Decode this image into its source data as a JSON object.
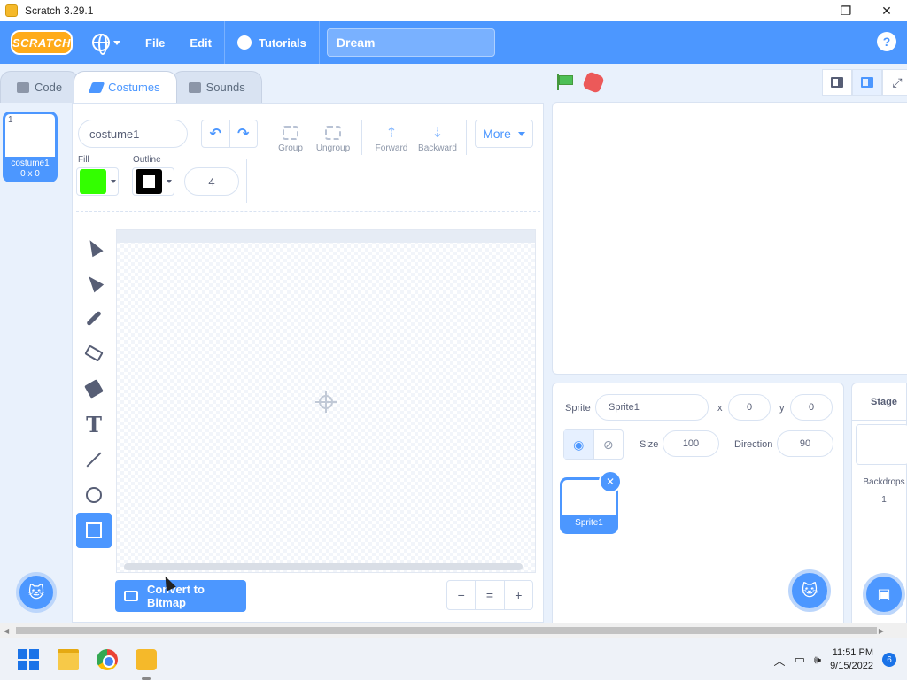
{
  "window": {
    "title": "Scratch 3.29.1",
    "controls": [
      "—",
      "❐",
      "✕"
    ]
  },
  "menubar": {
    "logo": "SCRATCH",
    "file": "File",
    "edit": "Edit",
    "tutorials": "Tutorials",
    "project_title": "Dream",
    "help": "?"
  },
  "tabs": [
    {
      "label": "Code",
      "icon": "code-icon"
    },
    {
      "label": "Costumes",
      "icon": "brush-icon",
      "active": true
    },
    {
      "label": "Sounds",
      "icon": "speaker-icon"
    }
  ],
  "costume_list": {
    "items": [
      {
        "number": "1",
        "name": "costume1",
        "size": "0 x 0"
      }
    ]
  },
  "paint_editor": {
    "costume_name": "costume1",
    "group_label": "Group",
    "ungroup_label": "Ungroup",
    "forward_label": "Forward",
    "backward_label": "Backward",
    "more_label": "More",
    "fill_label": "Fill",
    "outline_label": "Outline",
    "fill_color": "#33ff00",
    "outline_color": "#000000",
    "outline_width": "4",
    "convert_label": "Convert to Bitmap",
    "tools": [
      "select-icon",
      "reshape-icon",
      "brush-icon",
      "eraser-icon",
      "fill-icon",
      "text-icon",
      "line-icon",
      "circle-icon",
      "rectangle-icon"
    ],
    "active_tool": "rectangle-icon",
    "zoom": {
      "out": "−",
      "reset": "=",
      "in": "+"
    }
  },
  "sprite_info": {
    "sprite_label": "Sprite",
    "sprite_name": "Sprite1",
    "x_label": "x",
    "x_value": "0",
    "y_label": "y",
    "y_value": "0",
    "size_label": "Size",
    "size_value": "100",
    "direction_label": "Direction",
    "direction_value": "90"
  },
  "sprite_list": {
    "items": [
      {
        "name": "Sprite1"
      }
    ]
  },
  "stage_panel": {
    "title": "Stage",
    "backdrops_label": "Backdrops",
    "backdrops_count": "1"
  },
  "taskbar": {
    "time": "11:51 PM",
    "date": "9/15/2022",
    "notifications": "6"
  },
  "colors": {
    "accent": "#4c97ff",
    "menubar": "#4c97ff",
    "flag": "#4cbf56",
    "stop": "#ec5959"
  }
}
